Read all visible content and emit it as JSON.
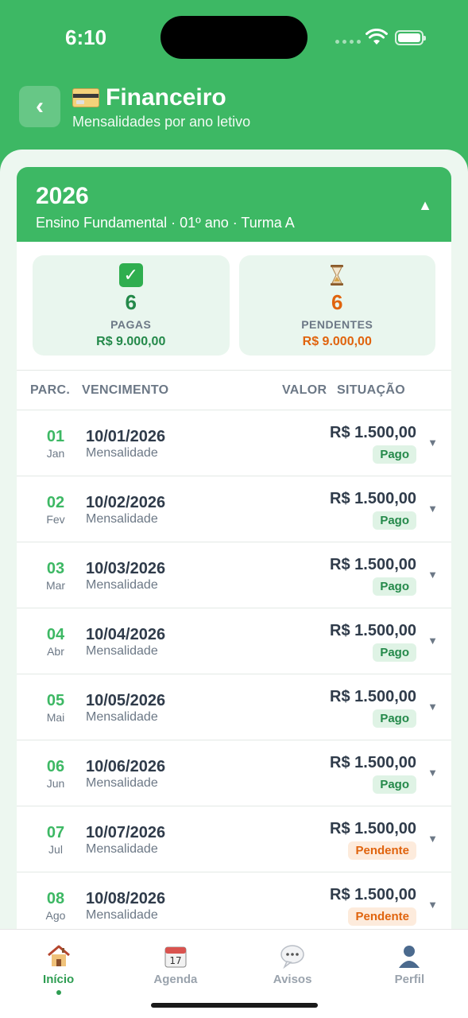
{
  "status_bar": {
    "time": "6:10"
  },
  "header": {
    "title": "Financeiro",
    "subtitle": "Mensalidades por ano letivo",
    "icon": "credit-card-icon"
  },
  "year": {
    "title": "2026",
    "subtitle": "Ensino Fundamental · 01º ano · Turma A",
    "expanded": true
  },
  "summary": {
    "paid": {
      "count": "6",
      "label": "PAGAS",
      "amount": "R$ 9.000,00",
      "icon": "check-icon"
    },
    "pending": {
      "count": "6",
      "label": "PENDENTES",
      "amount": "R$ 9.000,00",
      "icon": "hourglass-icon"
    }
  },
  "table": {
    "headers": {
      "parc": "PARC.",
      "vencimento": "VENCIMENTO",
      "valor": "VALOR",
      "situacao": "SITUAÇÃO"
    },
    "rows": [
      {
        "num": "01",
        "month": "Jan",
        "date": "10/01/2026",
        "type": "Mensalidade",
        "value": "R$ 1.500,00",
        "status": "Pago",
        "status_key": "pago"
      },
      {
        "num": "02",
        "month": "Fev",
        "date": "10/02/2026",
        "type": "Mensalidade",
        "value": "R$ 1.500,00",
        "status": "Pago",
        "status_key": "pago"
      },
      {
        "num": "03",
        "month": "Mar",
        "date": "10/03/2026",
        "type": "Mensalidade",
        "value": "R$ 1.500,00",
        "status": "Pago",
        "status_key": "pago"
      },
      {
        "num": "04",
        "month": "Abr",
        "date": "10/04/2026",
        "type": "Mensalidade",
        "value": "R$ 1.500,00",
        "status": "Pago",
        "status_key": "pago"
      },
      {
        "num": "05",
        "month": "Mai",
        "date": "10/05/2026",
        "type": "Mensalidade",
        "value": "R$ 1.500,00",
        "status": "Pago",
        "status_key": "pago"
      },
      {
        "num": "06",
        "month": "Jun",
        "date": "10/06/2026",
        "type": "Mensalidade",
        "value": "R$ 1.500,00",
        "status": "Pago",
        "status_key": "pago"
      },
      {
        "num": "07",
        "month": "Jul",
        "date": "10/07/2026",
        "type": "Mensalidade",
        "value": "R$ 1.500,00",
        "status": "Pendente",
        "status_key": "pendente"
      },
      {
        "num": "08",
        "month": "Ago",
        "date": "10/08/2026",
        "type": "Mensalidade",
        "value": "R$ 1.500,00",
        "status": "Pendente",
        "status_key": "pendente"
      }
    ]
  },
  "tabs": [
    {
      "label": "Início",
      "icon": "house-icon",
      "active": true
    },
    {
      "label": "Agenda",
      "icon": "calendar-icon",
      "active": false
    },
    {
      "label": "Avisos",
      "icon": "speech-bubble-icon",
      "active": false
    },
    {
      "label": "Perfil",
      "icon": "person-icon",
      "active": false
    }
  ],
  "colors": {
    "brand_green": "#3db864",
    "paid_green": "#24894a",
    "pending_orange": "#e0640e"
  }
}
